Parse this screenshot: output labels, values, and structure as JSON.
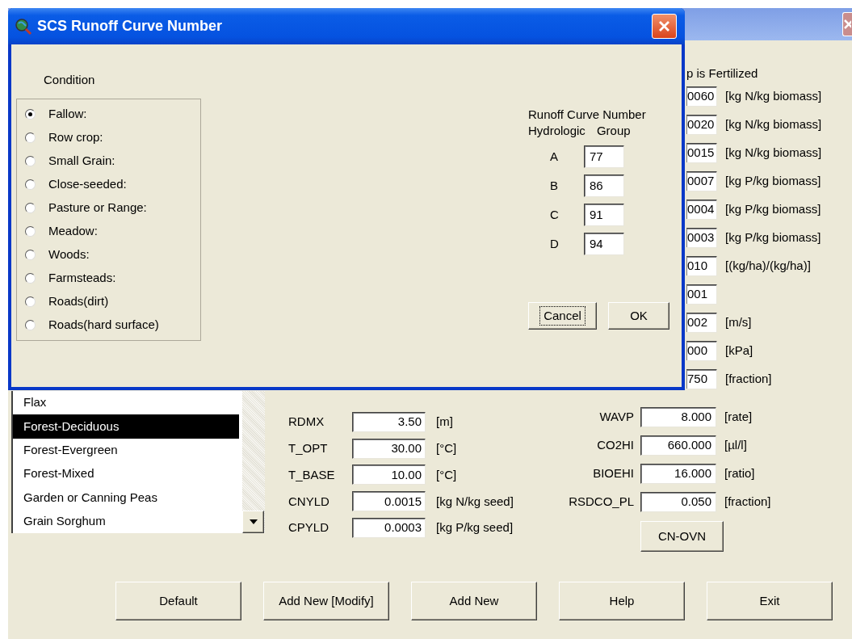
{
  "main_window": {
    "fertilizer_header": "p is Fertilized",
    "upper_params": [
      {
        "value": "0060",
        "unit": "[kg N/kg biomass]"
      },
      {
        "value": "0020",
        "unit": "[kg N/kg biomass]"
      },
      {
        "value": "0015",
        "unit": "[kg N/kg biomass]"
      },
      {
        "value": "0007",
        "unit": "[kg P/kg biomass]"
      },
      {
        "value": "0004",
        "unit": "[kg P/kg biomass]"
      },
      {
        "value": "0003",
        "unit": "[kg P/kg biomass]"
      },
      {
        "value": "010",
        "unit": "[(kg/ha)/(kg/ha)]"
      },
      {
        "value": "001"
      },
      {
        "value": "002",
        "unit": "[m/s]"
      },
      {
        "value": "000",
        "unit": "[kPa]"
      },
      {
        "value": "750",
        "unit": "[fraction]"
      }
    ],
    "crop_list": [
      {
        "label": "Flax",
        "selected": false
      },
      {
        "label": "Forest-Deciduous",
        "selected": true
      },
      {
        "label": "Forest-Evergreen",
        "selected": false
      },
      {
        "label": "Forest-Mixed",
        "selected": false
      },
      {
        "label": "Garden or Canning Peas",
        "selected": false
      },
      {
        "label": "Grain Sorghum",
        "selected": false
      }
    ],
    "crop_params": [
      {
        "label": "RDMX",
        "value": "3.50",
        "unit": "[m]"
      },
      {
        "label": "T_OPT",
        "value": "30.00",
        "unit": "[°C]"
      },
      {
        "label": "T_BASE",
        "value": "10.00",
        "unit": "[°C]"
      },
      {
        "label": "CNYLD",
        "value": "0.0015",
        "unit": "[kg N/kg seed]"
      },
      {
        "label": "CPYLD",
        "value": "0.0003",
        "unit": "[kg P/kg seed]"
      }
    ],
    "plant_params": [
      {
        "label": "WAVP",
        "value": "8.000",
        "unit": "[rate]"
      },
      {
        "label": "CO2HI",
        "value": "660.000",
        "unit": "[µl/l]"
      },
      {
        "label": "BIOEHI",
        "value": "16.000",
        "unit": "[ratio]"
      },
      {
        "label": "RSDCO_PL",
        "value": "0.050",
        "unit": "[fraction]"
      }
    ],
    "cn_ovn_button": "CN-OVN",
    "buttons": [
      "Default",
      "Add New [Modify]",
      "Add New",
      "Help",
      "Exit"
    ]
  },
  "dialog": {
    "title": "SCS Runoff Curve Number",
    "condition_label": "Condition",
    "conditions": [
      {
        "label": "Fallow:",
        "selected": true
      },
      {
        "label": "Row crop:",
        "selected": false
      },
      {
        "label": "Small Grain:",
        "selected": false
      },
      {
        "label": "Close-seeded:",
        "selected": false
      },
      {
        "label": "Pasture or Range:",
        "selected": false
      },
      {
        "label": "Meadow:",
        "selected": false
      },
      {
        "label": "Woods:",
        "selected": false
      },
      {
        "label": "Farmsteads:",
        "selected": false
      },
      {
        "label": "Roads(dirt)",
        "selected": false
      },
      {
        "label": "Roads(hard surface)",
        "selected": false
      }
    ],
    "runoff_header": {
      "line1": "Runoff Curve Number",
      "col1": "Hydrologic",
      "col2": "Group"
    },
    "groups": [
      {
        "letter": "A",
        "value": "77"
      },
      {
        "letter": "B",
        "value": "86"
      },
      {
        "letter": "C",
        "value": "91"
      },
      {
        "letter": "D",
        "value": "94"
      }
    ],
    "buttons": [
      {
        "label": "Cancel",
        "focused": true
      },
      {
        "label": "OK",
        "focused": false
      }
    ]
  }
}
